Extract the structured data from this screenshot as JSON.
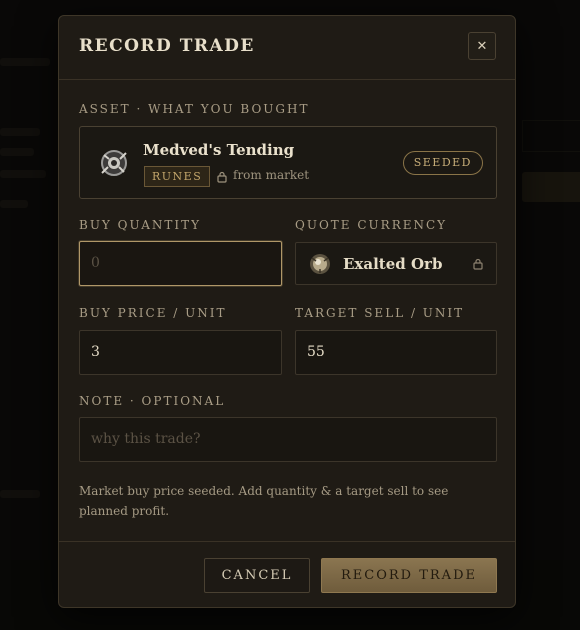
{
  "modal": {
    "title": "RECORD TRADE",
    "close_icon": "close-icon",
    "asset_label": "ASSET · WHAT YOU BOUGHT",
    "asset": {
      "name": "Medved's Tending",
      "category": "RUNES",
      "source": "from market",
      "badge": "SEEDED",
      "icon": "rune-item-icon"
    },
    "buy_quantity": {
      "label": "BUY QUANTITY",
      "value": "",
      "placeholder": "0"
    },
    "quote_currency": {
      "label": "QUOTE CURRENCY",
      "value": "Exalted Orb",
      "icon": "exalted-orb-icon",
      "locked": true
    },
    "buy_price": {
      "label": "BUY PRICE / UNIT",
      "value": "3"
    },
    "target_sell": {
      "label": "TARGET SELL / UNIT",
      "value": "55"
    },
    "note": {
      "label": "NOTE · OPTIONAL",
      "value": "",
      "placeholder": "why this trade?"
    },
    "hint": "Market buy price seeded. Add quantity & a target sell to see planned profit.",
    "cancel_label": "CANCEL",
    "record_label": "RECORD TRADE"
  },
  "colors": {
    "accent": "#b09768",
    "modal_bg": "#1f1b15",
    "primary_button": "#7d6846"
  }
}
